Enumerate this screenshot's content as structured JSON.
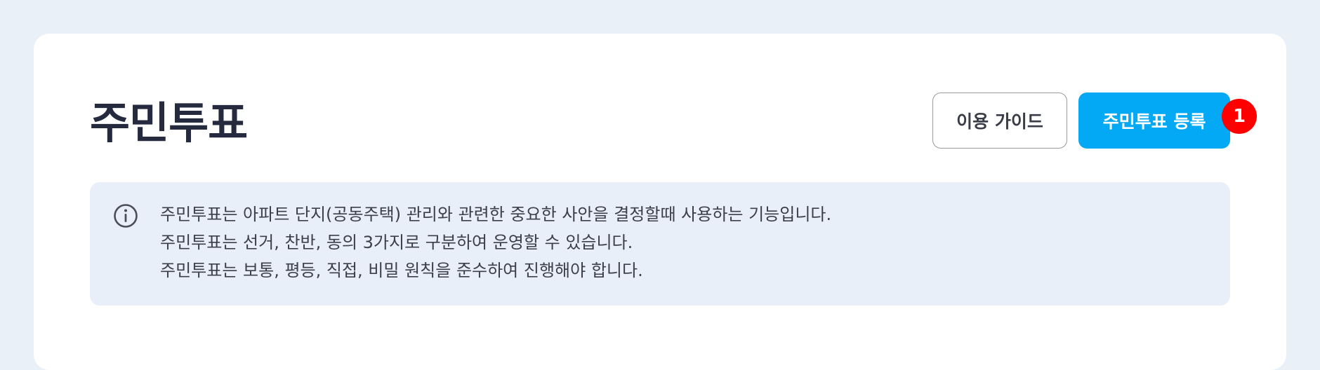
{
  "header": {
    "title": "주민투표"
  },
  "actions": {
    "guide_label": "이용 가이드",
    "register_label": "주민투표 등록",
    "badge_count": "1"
  },
  "info": {
    "icon": "info-circle-icon",
    "lines": [
      "주민투표는 아파트 단지(공동주택) 관리와 관련한 중요한 사안을 결정할때 사용하는 기능입니다.",
      "주민투표는 선거, 찬반, 동의 3가지로 구분하여 운영할 수 있습니다.",
      "주민투표는 보통, 평등, 직접, 비밀 원칙을 준수하여 진행해야 합니다."
    ]
  },
  "colors": {
    "page_background": "#eaf0f8",
    "card_background": "#ffffff",
    "title_text": "#262a3f",
    "primary_button": "#03a9f4",
    "badge": "#ff0000",
    "info_background": "#e9eff8",
    "info_text": "#3b3f4a"
  }
}
